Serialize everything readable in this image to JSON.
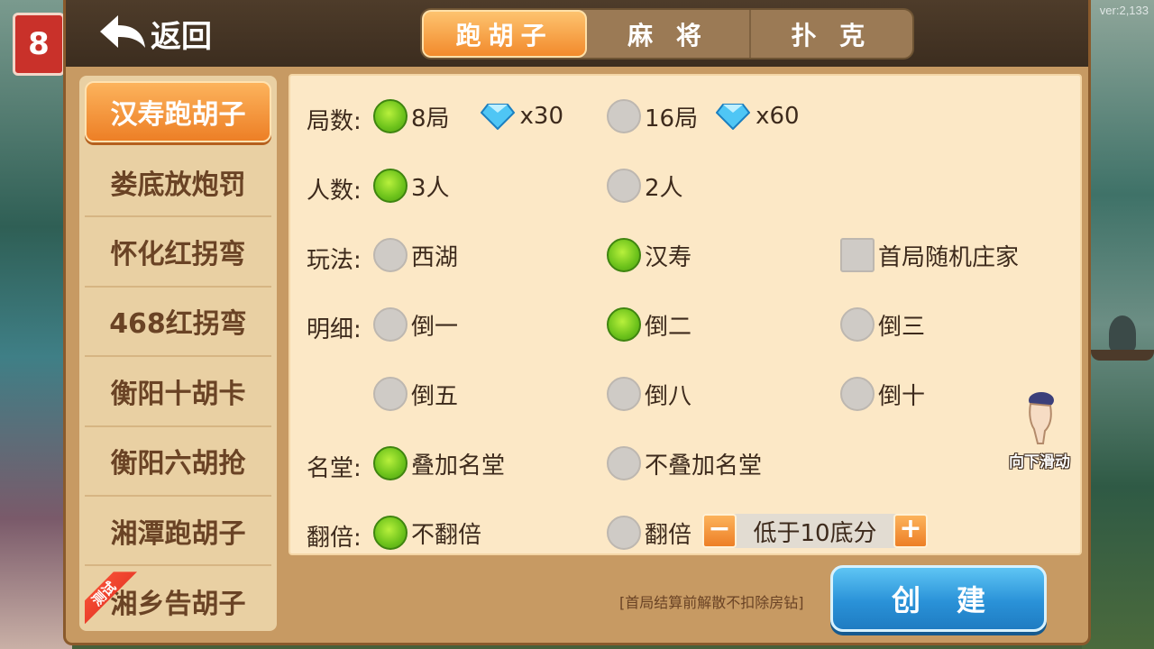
{
  "app": {
    "version": "ver:2,133",
    "logo_text": "8",
    "back_label": "返回"
  },
  "tabs": [
    {
      "label": "跑胡子",
      "active": true
    },
    {
      "label": "麻 将",
      "active": false
    },
    {
      "label": "扑 克",
      "active": false
    }
  ],
  "sidebar": {
    "items": [
      {
        "label": "汉寿跑胡子",
        "active": true
      },
      {
        "label": "娄底放炮罚",
        "active": false
      },
      {
        "label": "怀化红拐弯",
        "active": false
      },
      {
        "label": "468红拐弯",
        "active": false
      },
      {
        "label": "衡阳十胡卡",
        "active": false
      },
      {
        "label": "衡阳六胡抢",
        "active": false
      },
      {
        "label": "湘潭跑胡子",
        "active": false
      },
      {
        "label": "湘乡告胡子",
        "active": false,
        "badge": "测试"
      }
    ]
  },
  "options": {
    "rounds": {
      "label": "局数:",
      "choices": [
        {
          "label": "8局",
          "checked": true,
          "cost": "x30"
        },
        {
          "label": "16局",
          "checked": false,
          "cost": "x60"
        }
      ]
    },
    "players": {
      "label": "人数:",
      "choices": [
        {
          "label": "3人",
          "checked": true
        },
        {
          "label": "2人",
          "checked": false
        }
      ]
    },
    "mode": {
      "label": "玩法:",
      "choices": [
        {
          "label": "西湖",
          "checked": false
        },
        {
          "label": "汉寿",
          "checked": true
        }
      ],
      "checkbox": {
        "label": "首局随机庄家",
        "checked": false
      }
    },
    "detail": {
      "label": "明细:",
      "choices": [
        {
          "label": "倒一",
          "checked": false
        },
        {
          "label": "倒二",
          "checked": true
        },
        {
          "label": "倒三",
          "checked": false
        },
        {
          "label": "倒五",
          "checked": false
        },
        {
          "label": "倒八",
          "checked": false
        },
        {
          "label": "倒十",
          "checked": false
        }
      ]
    },
    "hall": {
      "label": "名堂:",
      "choices": [
        {
          "label": "叠加名堂",
          "checked": true
        },
        {
          "label": "不叠加名堂",
          "checked": false
        }
      ]
    },
    "double": {
      "label": "翻倍:",
      "choices": [
        {
          "label": "不翻倍",
          "checked": true
        },
        {
          "label": "翻倍",
          "checked": false
        }
      ],
      "stepper_value": "低于10底分",
      "minus": "−",
      "plus": "+"
    }
  },
  "scroll_hint": "向下滑动",
  "footer": {
    "note": "[首局结算前解散不扣除房钻]",
    "create_label": "创建"
  },
  "colors": {
    "accent_orange": "#f28a2c",
    "radio_on": "#6cc21b",
    "create_blue": "#2a92d8",
    "panel_brown": "#c79a63"
  }
}
